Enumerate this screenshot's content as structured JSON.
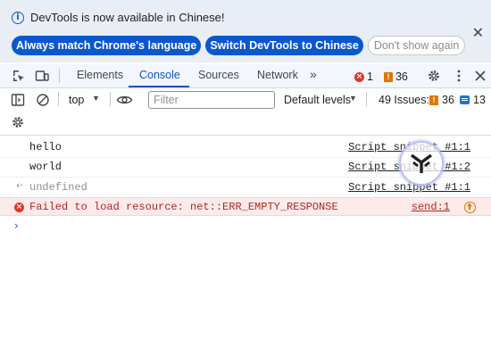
{
  "banner": {
    "text": "DevTools is now available in Chinese!",
    "buttons": {
      "match_language": "Always match Chrome's language",
      "switch_chinese": "Switch DevTools to Chinese",
      "dont_show": "Don't show again"
    },
    "close_icon": "close-icon"
  },
  "tabs": {
    "elements": "Elements",
    "console": "Console",
    "sources": "Sources",
    "network": "Network",
    "more": "»",
    "active": "Console",
    "error_count": "1",
    "warning_count": "36"
  },
  "console_toolbar": {
    "context": "top",
    "filter_placeholder": "Filter",
    "levels": "Default levels",
    "issues_label": "49 Issues:",
    "issues_warnings": "36",
    "issues_info": "13"
  },
  "messages": [
    {
      "text": "hello",
      "source": "Script snippet #1:1"
    },
    {
      "text": "world",
      "source": "Script snippet #1:2"
    },
    {
      "text": "undefined",
      "source": "Script snippet #1:1",
      "kind": "return"
    },
    {
      "text": "Failed to load resource: net::ERR_EMPTY_RESPONSE",
      "source": "send:1",
      "kind": "error"
    }
  ],
  "prompt_symbol": "›",
  "colors": {
    "accent": "#0b57d0",
    "banner_bg": "#e9eef6",
    "error": "#dc362e",
    "warning": "#e37400",
    "error_row_bg": "#fcebeb"
  }
}
